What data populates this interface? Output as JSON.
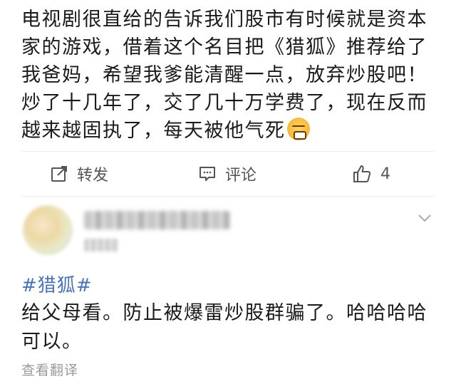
{
  "post": {
    "text": "电视剧很直给的告诉我们股市有时候就是资本家的游戏，借着这个名目把《猎狐》推荐给了我爸妈，希望我爹能清醒一点，放弃炒股吧！炒了十几年了，交了几十万学费了，现在反而越来越固执了，每天被他气死",
    "emoji_icon": "furious-face-emoji"
  },
  "actions": {
    "share_label": "转发",
    "comment_label": "评论",
    "like_count": "4"
  },
  "comment": {
    "hashtag": "#猎狐#",
    "text": "给父母看。防止被爆雷炒股群骗了。哈哈哈哈可以。",
    "translate_label": "查看翻译"
  },
  "colors": {
    "hashtag": "#4a73b5",
    "action_text": "#555555",
    "secondary_text": "#9a9a9a"
  }
}
